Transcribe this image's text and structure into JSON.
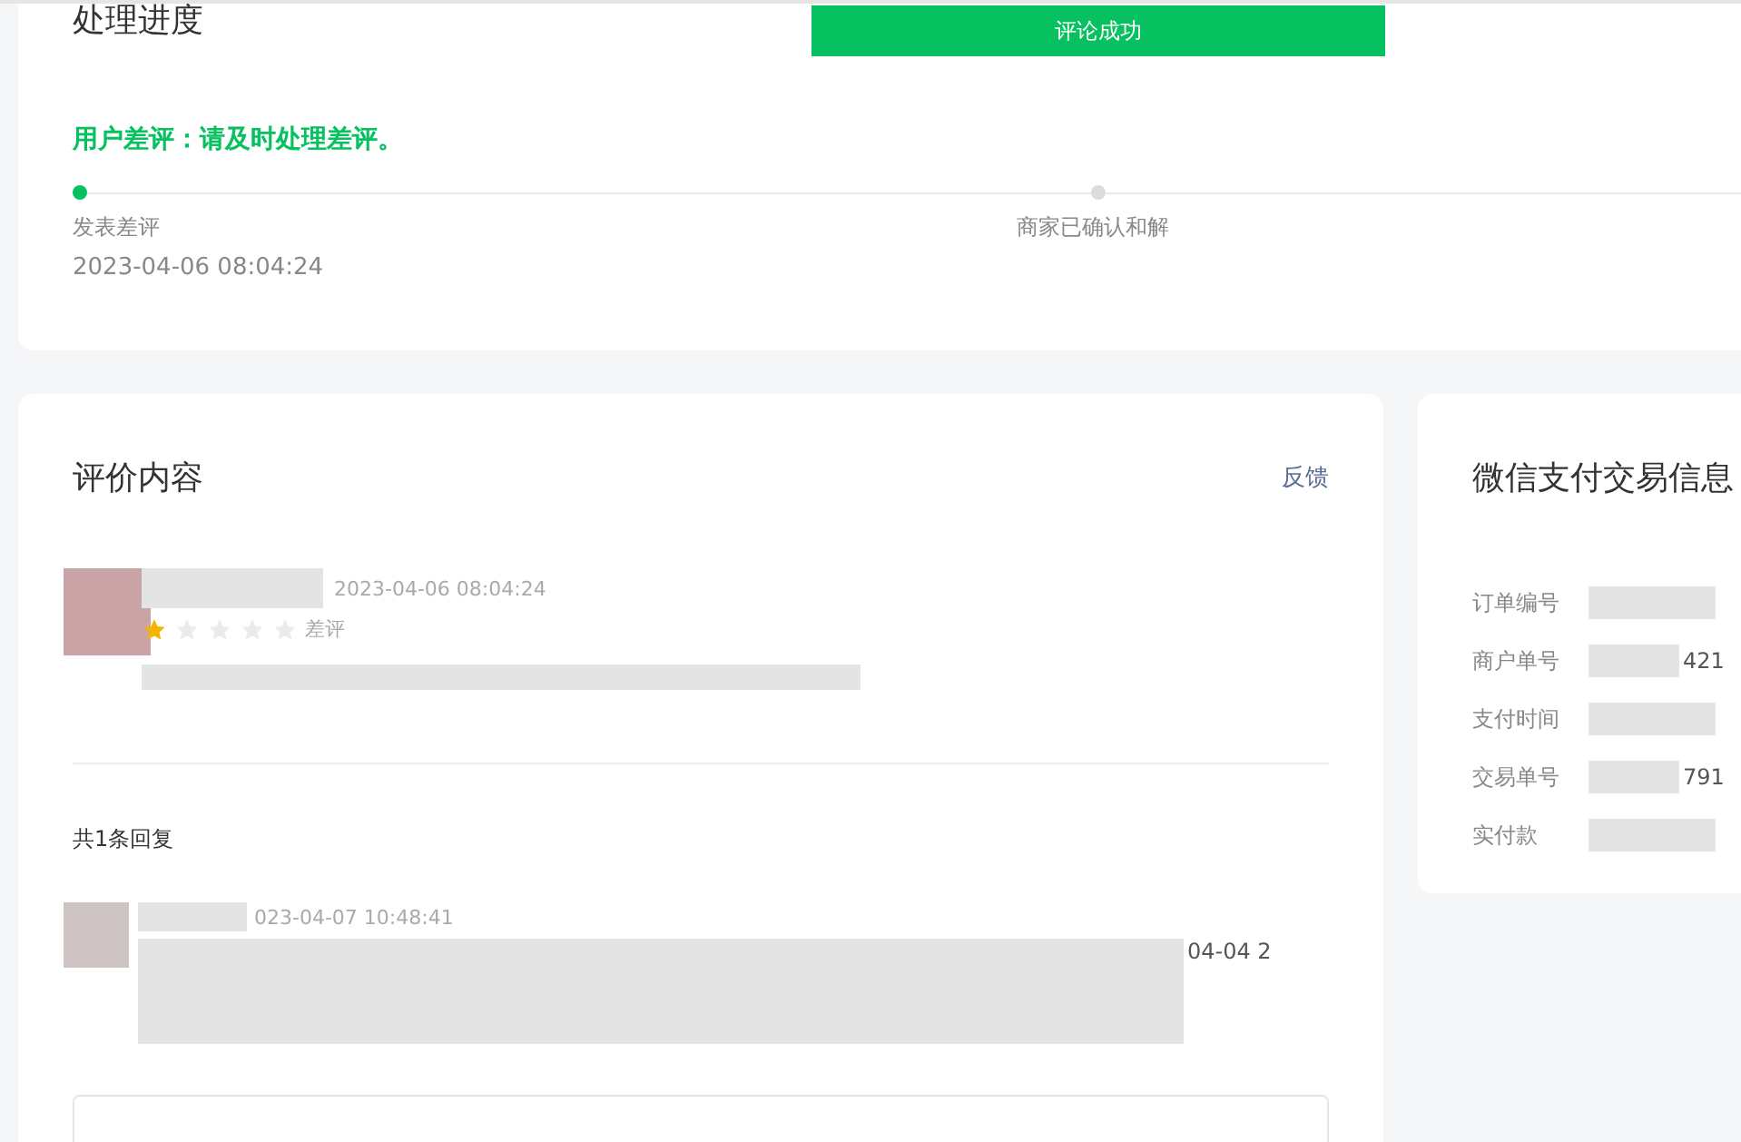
{
  "progress": {
    "title": "处理进度",
    "banner": "评论成功",
    "notice": "用户差评：请及时处理差评。",
    "steps": [
      {
        "label": "发表差评",
        "time": "2023-04-06 08:04:24",
        "done": true
      },
      {
        "label": "商家已确认和解",
        "done": false
      }
    ]
  },
  "review": {
    "title": "评价内容",
    "feedback_link": "反馈",
    "comment": {
      "time": "2023-04-06 08:04:24",
      "stars": 1,
      "rating_label": "差评"
    },
    "reply_count": "共1条回复",
    "reply": {
      "time": "023-04-07 10:48:41",
      "text_fragment": "04-04 2"
    }
  },
  "payment": {
    "title": "微信支付交易信息",
    "fields": [
      {
        "label": "订单编号"
      },
      {
        "label": "商户单号",
        "value_fragment": "421"
      },
      {
        "label": "支付时间"
      },
      {
        "label": "交易单号",
        "value_fragment": "791"
      },
      {
        "label": "实付款"
      }
    ]
  }
}
